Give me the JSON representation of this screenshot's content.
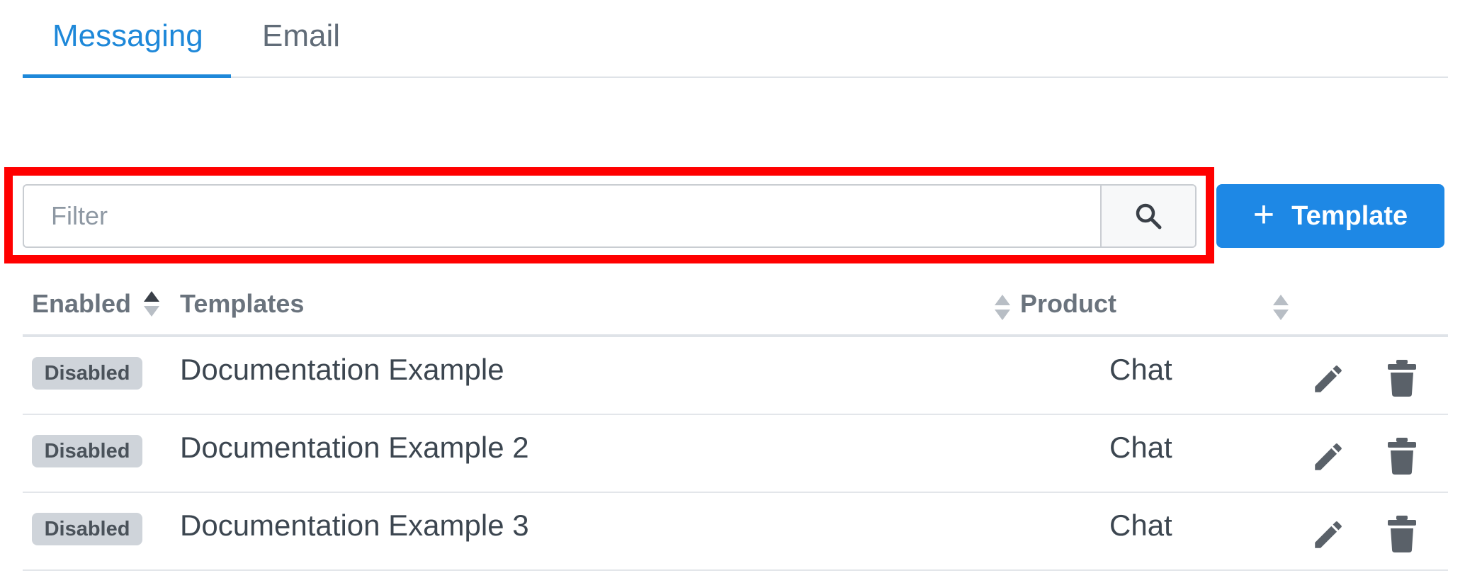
{
  "tabs": [
    {
      "label": "Messaging",
      "active": true
    },
    {
      "label": "Email",
      "active": false
    }
  ],
  "filter": {
    "placeholder": "Filter",
    "value": ""
  },
  "icons": {
    "search": "search-icon",
    "edit": "pencil-icon",
    "delete": "trash-icon",
    "sort": "sort-icon",
    "add": "plus-icon"
  },
  "add_button": {
    "icon": "+",
    "label": "Template"
  },
  "table": {
    "columns": [
      "Enabled",
      "Templates",
      "Product"
    ],
    "rows": [
      {
        "status": "Disabled",
        "name": "Documentation Example",
        "product": "Chat"
      },
      {
        "status": "Disabled",
        "name": "Documentation Example 2",
        "product": "Chat"
      },
      {
        "status": "Disabled",
        "name": "Documentation Example 3",
        "product": "Chat"
      }
    ]
  },
  "colors": {
    "accent": "#1e88e5",
    "highlight": "#ff0000",
    "badge_bg": "#cfd4da"
  }
}
